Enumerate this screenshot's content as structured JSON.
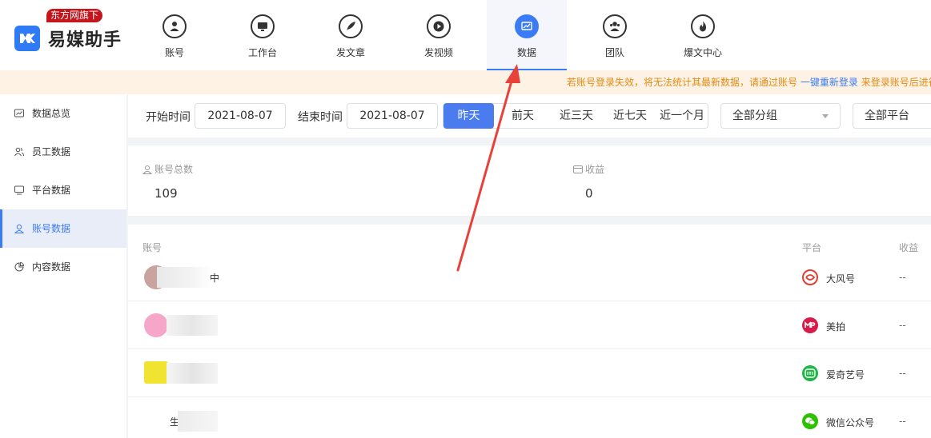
{
  "brand": {
    "badge": "东方网旗下",
    "name": "易媒助手"
  },
  "nav": {
    "items": [
      {
        "label": "账号",
        "icon": "user-icon"
      },
      {
        "label": "工作台",
        "icon": "monitor-icon"
      },
      {
        "label": "发文章",
        "icon": "feather-icon"
      },
      {
        "label": "发视频",
        "icon": "play-icon"
      },
      {
        "label": "数据",
        "icon": "chart-icon",
        "active": true
      },
      {
        "label": "团队",
        "icon": "team-icon"
      },
      {
        "label": "爆文中心",
        "icon": "fire-icon"
      }
    ]
  },
  "notice": {
    "warning": "若账号登录失效，将无法统计其最新数据，请通过账号",
    "link": "一键重新登录",
    "tail": "来登录账号后进行"
  },
  "sidebar": {
    "items": [
      {
        "label": "数据总览",
        "icon": "trend-icon"
      },
      {
        "label": "员工数据",
        "icon": "staff-icon"
      },
      {
        "label": "平台数据",
        "icon": "platform-icon"
      },
      {
        "label": "账号数据",
        "icon": "account-icon",
        "active": true
      },
      {
        "label": "内容数据",
        "icon": "pie-icon"
      }
    ]
  },
  "filters": {
    "start_label": "开始时间",
    "start_value": "2021-08-07",
    "end_label": "结束时间",
    "end_value": "2021-08-07",
    "quick": [
      "昨天",
      "前天",
      "近三天",
      "近七天",
      "近一个月"
    ],
    "quick_active": "昨天",
    "group_select": "全部分组",
    "platform_select": "全部平台"
  },
  "stats": {
    "accounts_label": "账号总数",
    "accounts_value": "109",
    "income_label": "收益",
    "income_value": "0"
  },
  "table": {
    "headers": {
      "account": "账号",
      "platform": "平台",
      "income": "收益"
    },
    "rows": [
      {
        "account_visible": "中",
        "platform": "大风号",
        "platform_icon": "dafeng-icon",
        "income": "--"
      },
      {
        "account_visible": "",
        "platform": "美拍",
        "platform_icon": "meipai-icon",
        "income": "--"
      },
      {
        "account_visible": "",
        "platform": "爱奇艺号",
        "platform_icon": "iqiyi-icon",
        "income": "--"
      },
      {
        "account_visible": "生",
        "platform": "微信公众号",
        "platform_icon": "wechat-icon",
        "income": "--"
      }
    ]
  },
  "colors": {
    "accent": "#3b7cf6",
    "warning": "#e48b16",
    "logo_badge": "#c4161c",
    "annotation_arrow": "#e8413a"
  }
}
